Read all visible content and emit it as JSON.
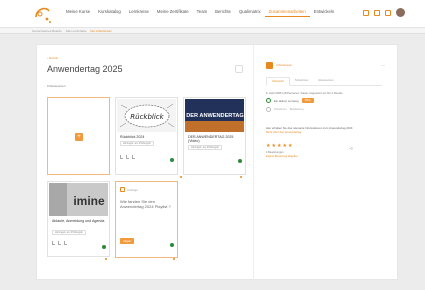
{
  "nav": {
    "items": [
      "Meine Kurse",
      "Kurskatalog",
      "Lernkreise",
      "Meine Zertifikate",
      "Team",
      "Berichte",
      "Qualimatrix",
      "Zusammenarbeiten",
      "Entwickeln"
    ],
    "active_index": 7
  },
  "breadcrumbs": [
    "Gemeinsames Boards",
    "Alle Lerninhalte",
    "Der Arbeitsraum"
  ],
  "page": {
    "back_label": "‹ Zurück",
    "title": "Anwendertag 2025",
    "resource_count": "9 Ressourcen"
  },
  "cards": [
    {
      "title": "Rückblick 2024",
      "tag": "Hinzugef. am Prüfungsb",
      "thumb_text": "Rückblick"
    },
    {
      "title": "DER ANWENDERTAG 2025 (Video)",
      "tag": "Hinzugef. am Prüfungsb",
      "thumb_text": "DER ANWENDERTAG"
    },
    {
      "title": "Ablaufe, Anmeldung und Agenda",
      "tag": "Hinzugef. am Prüfungsb",
      "thumb_text": "imine"
    }
  ],
  "poll": {
    "label": "Umfrage",
    "question": "Wie fanden Sie den Anwendertag 2024 Playlist ?",
    "button": "Abgeb"
  },
  "side": {
    "title": "Arbeitsraum",
    "tabs": [
      "Übersicht",
      "Teilnehmer",
      "Ressourcen"
    ],
    "date_text": "6. April 2025 (18 Personen, Dauer insgesamt ein bis 2 Stunde",
    "status_label": "Ein aktiver Lernweg",
    "action_button": "Öffne",
    "link_a": "Teilnehmer",
    "link_b": "Bearbeitung",
    "desc": "Hier erhalten Sie das relevante Informationen zum Anwendertag 2024",
    "desc_link": "Mehr über den Anwendertag",
    "stars_count": 5,
    "reviews": "1 Bewertungen",
    "reviews_link": "Eigene Bewertung abgeben"
  },
  "colors": {
    "accent": "#e8891e",
    "accent_fill": "#f29a3a",
    "status_green": "#2e8b3a"
  }
}
